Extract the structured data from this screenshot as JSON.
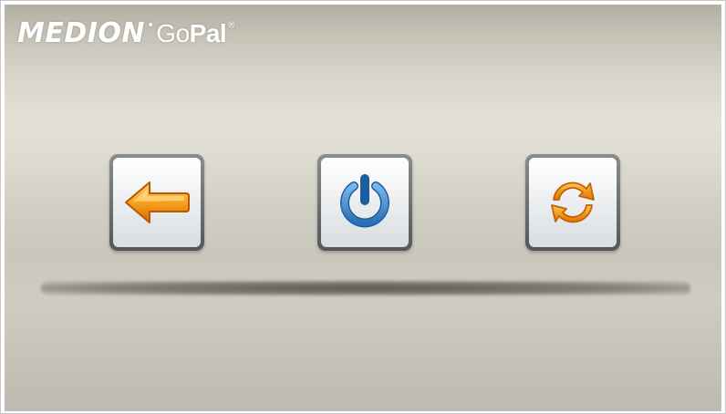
{
  "logo": {
    "brand": "MEDION",
    "product_light": "Go",
    "product_bold": "Pal",
    "tm": "®"
  },
  "buttons": [
    {
      "name": "back",
      "icon": "arrow-left-icon",
      "color": "#f39a1d"
    },
    {
      "name": "power",
      "icon": "power-icon",
      "color": "#3f86cf"
    },
    {
      "name": "refresh",
      "icon": "refresh-icon",
      "color": "#f39a1d"
    }
  ],
  "colors": {
    "orange": "#f39a1d",
    "blue": "#3f86cf"
  }
}
